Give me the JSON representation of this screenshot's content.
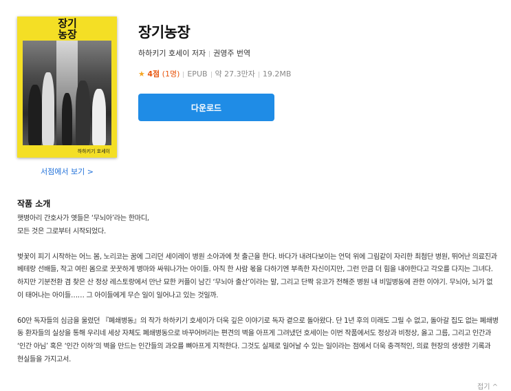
{
  "book": {
    "cover_title": "장기농장",
    "cover_author_small": "하하키기 호세이",
    "title": "장기농장",
    "author": "하하키기 호세이 저자",
    "translator": "권영주 번역",
    "rating": "4점",
    "rating_count": "(1명)",
    "format": "EPUB",
    "length": "약 27.3만자",
    "size": "19.2MB",
    "store_link": "서점에서 보기 >",
    "download_label": "다운로드"
  },
  "intro": {
    "heading": "작품 소개",
    "paragraphs": [
      "햇병아리 간호사가 엿들은 ‘무뇌아’라는 한마디,\n모든 것은 그로부터 시작되었다.",
      "벚꽃이 피기 시작하는 어느 봄, 노리코는 꿈에 그리던 세이레이 병원 소아과에 첫 출근을 한다. 바다가 내려다보이는 언덕 위에 그림같이 자리한 최첨단 병원, 뛰어난 의료진과 베테랑 선배들, 작고 여린 몸으로 꿋꿋하게 병마와 싸워나가는 아이들. 아직 한 사람 몫을 다하기엔 부족한 자신이지만, 그런 만큼 더 힘을 내야한다고 각오를 다지는 그녀다. 하지만 기분전환 겸 찾은 산 정상 레스토랑에서 만난 묘한 커플이 남긴 ‘무뇌아 출산’이라는 말, 그리고 단짝 유코가 전해준 병원 내 비밀병동에 관한 이야기. 무뇌아, 뇌가 없이 태어나는 아이들…… 그 아이들에게 무슨 일이 일어나고 있는 것일까.",
      "60만 독자들의 심금을 울렸던 『폐쇄병동』의 작가 하하키기 호세이가 더욱 깊은 이야기로 독자 곁으로 돌아왔다. 단 1년 후의 미래도 그릴 수 없고, 돌아갈 집도 없는 폐쇄병동 환자들의 실상을 통해 우리네 세상 자체도 폐쇄병동으로 바꾸어버리는 편견의 벽을 아프게 그려냈던 호세이는 이번 작품에서도 정상과 비정상, 옳고 그름, 그리고 인간과 ‘인간 아님’ 혹은 ‘인간 이하’의 벽을 만드는 인간들의 과오를 뼈아프게 지적한다. 그것도 실제로 일어날 수 있는 일이라는 점에서 더욱 충격적인, 의료 현장의 생생한 기록과 현실들을 가지고서."
    ],
    "collapse_label": "접기 ^"
  },
  "colors": {
    "accent": "#1f8ce6",
    "rating": "#e8560f",
    "star": "#f5a623",
    "cover_yellow": "#f4df25"
  }
}
